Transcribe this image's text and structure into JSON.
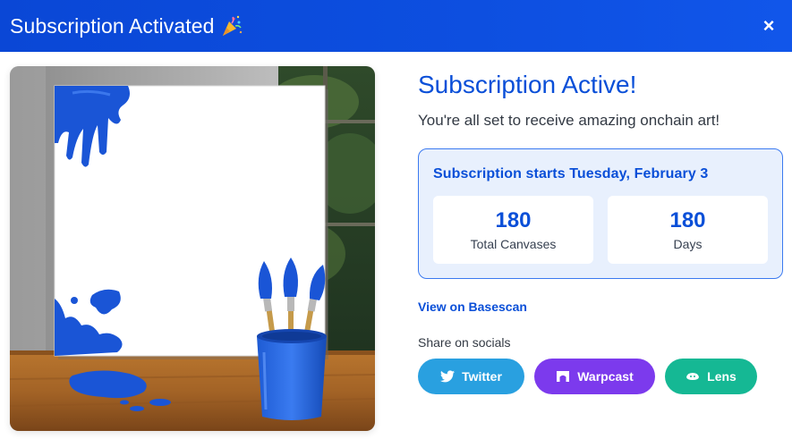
{
  "header": {
    "title": "Subscription Activated",
    "emoji_icon": "party-popper-icon",
    "close_label": "×",
    "background_color": "#0d4fe0"
  },
  "artwork": {
    "icon": "painting-canvas-with-brushes-illustration"
  },
  "main": {
    "headline": "Subscription Active!",
    "subline": "You're all set to receive amazing onchain art!",
    "subscription": {
      "start_text": "Subscription starts Tuesday, February 3",
      "stats": [
        {
          "value": "180",
          "label": "Total Canvases"
        },
        {
          "value": "180",
          "label": "Days"
        }
      ]
    },
    "basescan_link": "View on Basescan",
    "share_label": "Share on socials",
    "socials": [
      {
        "label": "Twitter",
        "icon": "twitter-bird-icon",
        "color": "#29a0e0"
      },
      {
        "label": "Warpcast",
        "icon": "warpcast-arch-icon",
        "color": "#7c3aed"
      },
      {
        "label": "Lens",
        "icon": "lens-leaf-icon",
        "color": "#15b894"
      }
    ]
  },
  "colors": {
    "accent": "#0a4fd8",
    "box_bg": "#e8f0fd",
    "box_border": "#3b7af0"
  }
}
